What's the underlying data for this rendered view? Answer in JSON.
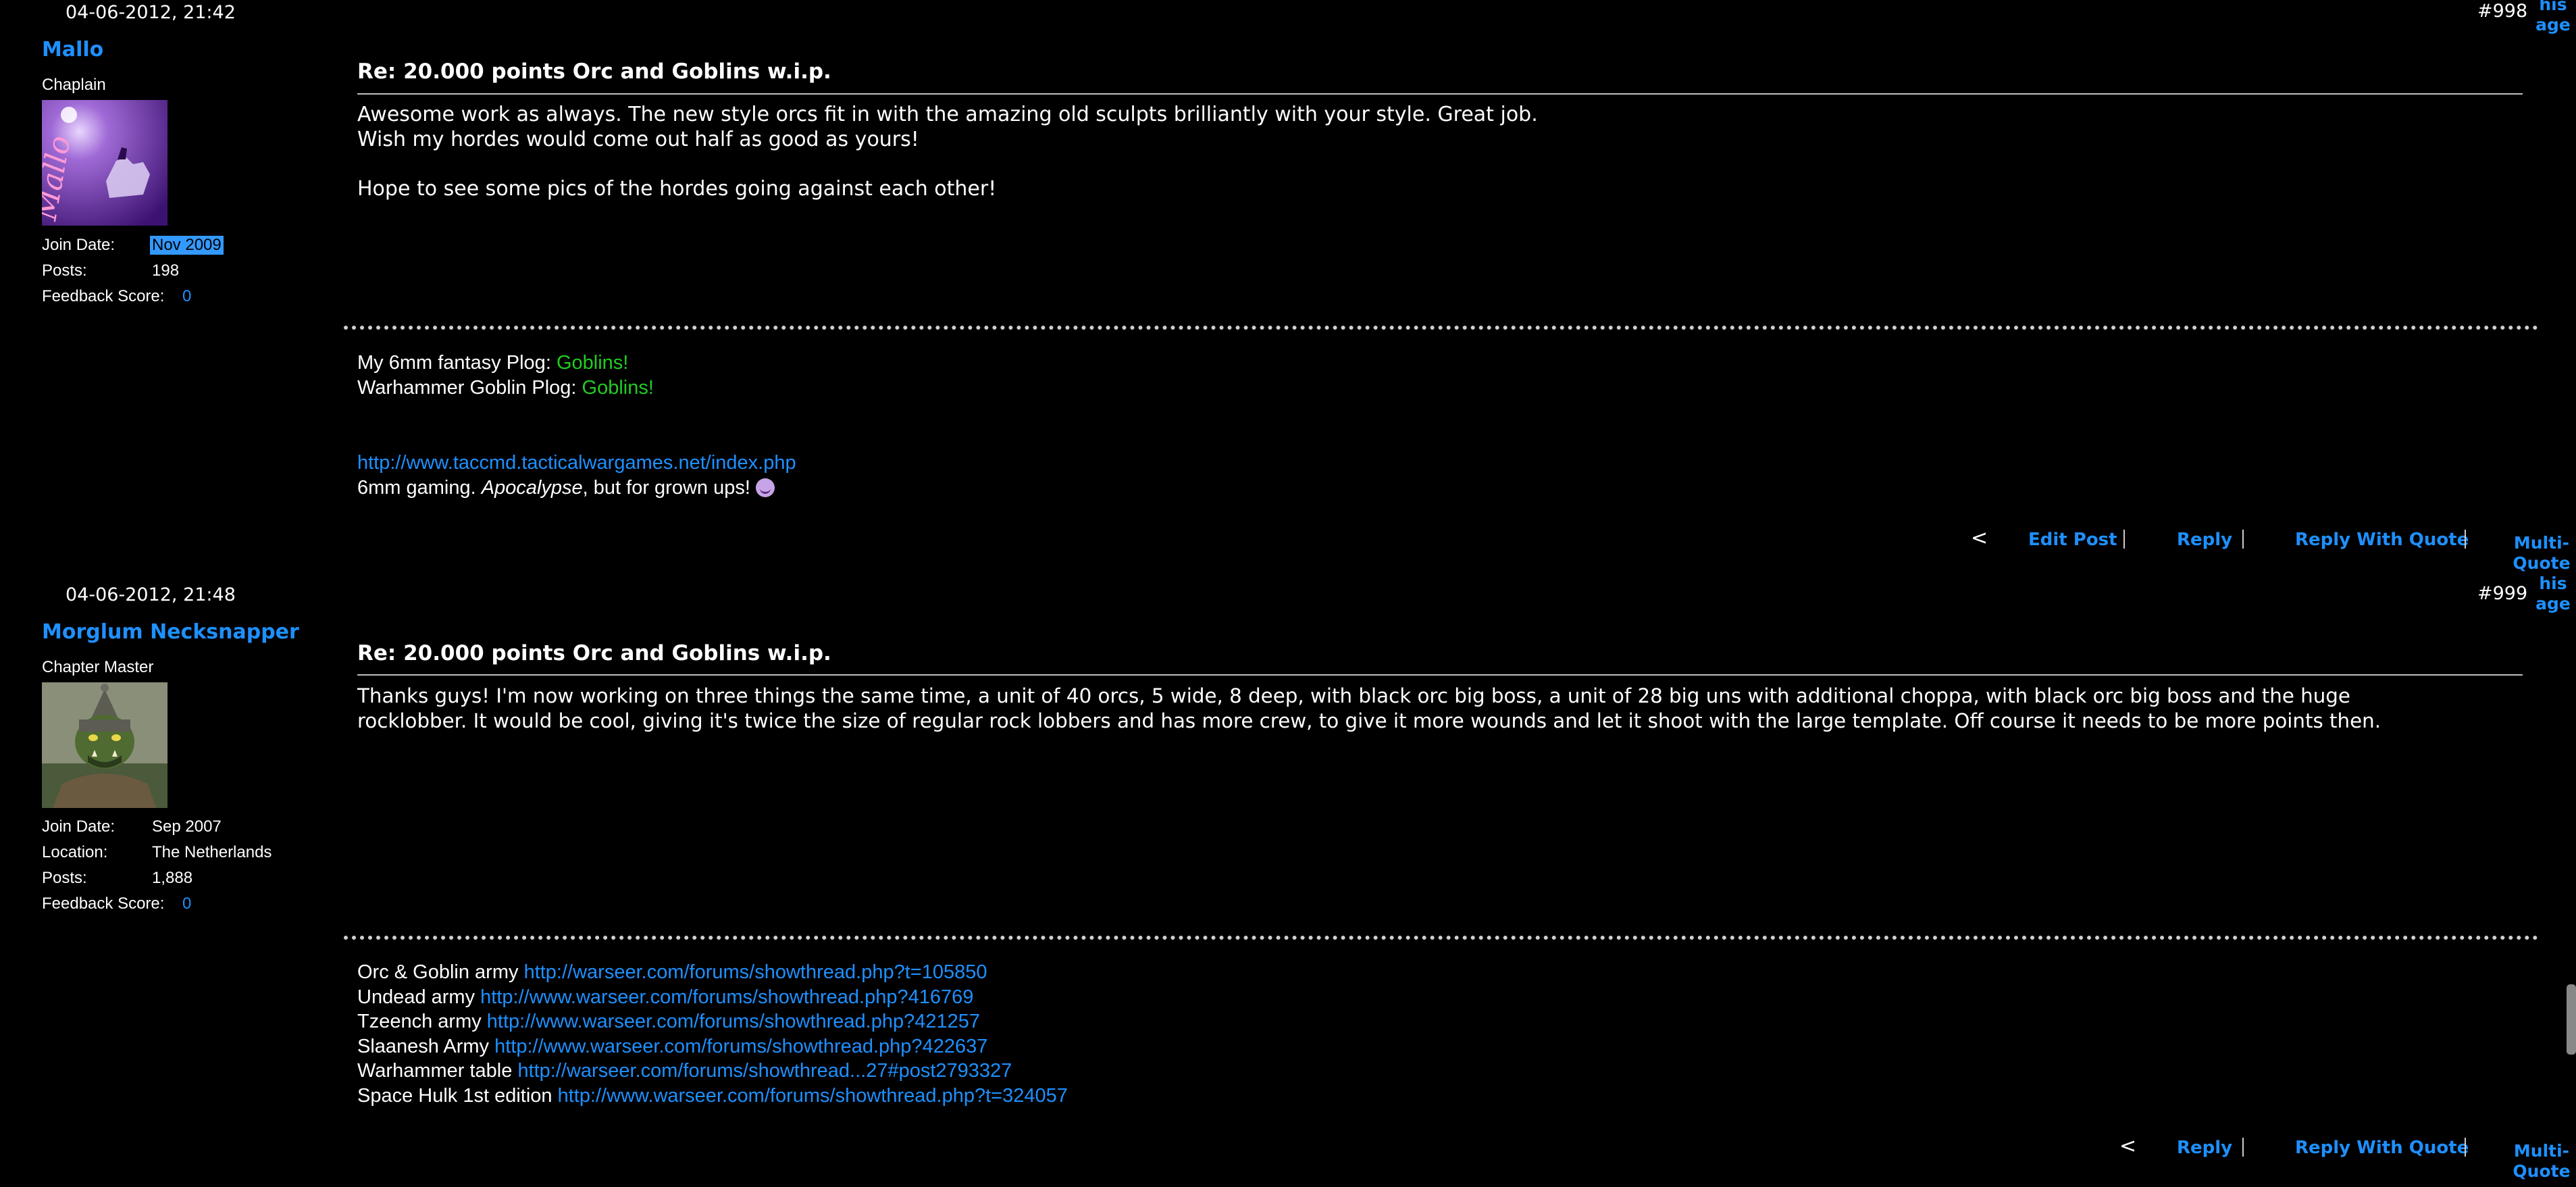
{
  "posts": [
    {
      "date": "04-06-2012, 21:42",
      "number": "#998",
      "user": {
        "name": "Mallo",
        "title": "Chaplain",
        "avatar_icon": "purple-knight-avatar",
        "avatar_text": "Mallo",
        "info": [
          {
            "label": "Join Date:",
            "value": "Nov 2009"
          },
          {
            "label": "Posts:",
            "value": "198"
          },
          {
            "label": "Feedback Score:",
            "value": "0"
          }
        ]
      },
      "title": "Re: 20.000 points Orc and Goblins w.i.p.",
      "message": [
        "Awesome work as always. The new style orcs fit in with the amazing old sculpts brilliantly with your style. Great job.",
        "Wish my hordes would come out half as good as yours!",
        "Hope to see some pics of the hordes going against each other!"
      ],
      "signature": {
        "line1_text": "My 6mm fantasy Plog: ",
        "line1_link": "Goblins!",
        "line2_text": "Warhammer Goblin Plog: ",
        "line2_link": "Goblins!",
        "url": "http://www.taccmd.tacticalwargames.net/index.php",
        "line4_a": "6mm gaming. ",
        "line4_em": "Apocalypse",
        "line4_b": ", but for grown ups! "
      },
      "actions": {
        "prev": "<",
        "edit": "Edit Post",
        "reply": "Reply",
        "quote": "Reply With Quote",
        "multi": [
          "Multi-",
          "Quote"
        ]
      }
    },
    {
      "date": "04-06-2012, 21:48",
      "number": "#999",
      "user": {
        "name": "Morglum Necksnapper",
        "title": "Chapter Master",
        "avatar_icon": "orc-warrior-avatar",
        "info": [
          {
            "label": "Join Date:",
            "value": "Sep 2007"
          },
          {
            "label": "Location:",
            "value": "The Netherlands"
          },
          {
            "label": "Posts:",
            "value": "1,888"
          },
          {
            "label": "Feedback Score:",
            "value": "0"
          }
        ]
      },
      "title": "Re: 20.000 points Orc and Goblins w.i.p.",
      "message": [
        "Thanks guys! I'm now working on three things the same time, a unit of 40 orcs, 5 wide, 8 deep, with black orc big boss, a unit of 28 big uns with additional choppa, with black orc big boss and the huge",
        "rocklobber. It would be cool, giving it's twice the size of regular rock lobbers and has more crew, to give it more wounds and let it shoot with the large template. Off course it needs to be more points then."
      ],
      "signature_lines": [
        {
          "text": "Orc & Goblin army ",
          "link": "http://warseer.com/forums/showthread.php?t=105850"
        },
        {
          "text": "Undead army ",
          "link": "http://www.warseer.com/forums/showthread.php?416769"
        },
        {
          "text": "Tzeench army ",
          "link": "http://www.warseer.com/forums/showthread.php?421257"
        },
        {
          "text": "Slaanesh Army ",
          "link": "http://www.warseer.com/forums/showthread.php?422637"
        },
        {
          "text": "Warhammer table ",
          "link": "http://warseer.com/forums/showthread...27#post2793327"
        },
        {
          "text": "Space Hulk 1st edition ",
          "link": "http://www.warseer.com/forums/showthread.php?t=324057"
        }
      ],
      "actions": {
        "prev": "<",
        "reply": "Reply",
        "quote": "Reply With Quote",
        "multi": [
          "Multi-",
          "Quote"
        ]
      }
    }
  ],
  "side_fragments": {
    "top": [
      "his",
      "age"
    ],
    "mid": [
      "his",
      "age"
    ]
  },
  "colors": {
    "background": "#000000",
    "link": "#1e90ff",
    "sig_green": "#22cc22",
    "selection": "#3399ff"
  }
}
